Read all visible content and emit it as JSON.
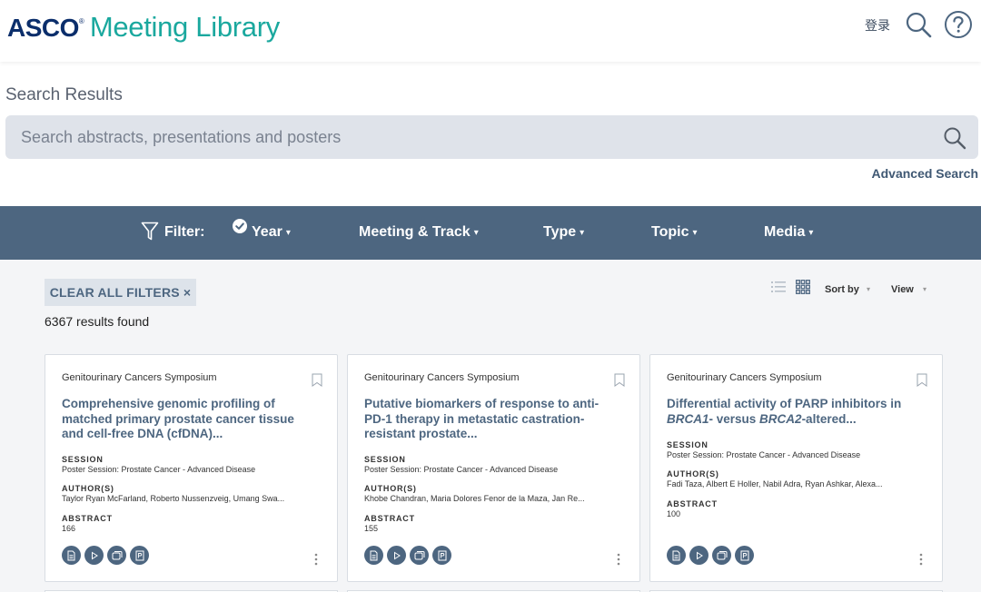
{
  "header": {
    "logo_asco": "ASCO",
    "logo_reg": "®",
    "logo_text": "Meeting Library",
    "login_label": "登录"
  },
  "search": {
    "title": "Search Results",
    "placeholder": "Search abstracts, presentations and posters",
    "value": "",
    "advanced_label": "Advanced Search"
  },
  "filterbar": {
    "filter_label": "Filter:",
    "items": [
      {
        "label": "Year",
        "checked": true
      },
      {
        "label": "Meeting & Track"
      },
      {
        "label": "Type"
      },
      {
        "label": "Topic"
      },
      {
        "label": "Media"
      }
    ],
    "caret": "▾"
  },
  "toolbar": {
    "clear_label": "CLEAR ALL FILTERS ×",
    "results_text": "6367 results found",
    "sort_label": "Sort by",
    "view_label": "View",
    "caret": "▾"
  },
  "cards": [
    {
      "meeting": "Genitourinary Cancers Symposium",
      "title": "Comprehensive genomic profiling of matched primary prostate cancer tissue and cell-free DNA (cfDNA)...",
      "session_label": "SESSION",
      "session": "Poster Session: Prostate Cancer - Advanced Disease",
      "authors_label": "AUTHOR(S)",
      "authors": "Taylor Ryan McFarland, Roberto Nussenzveig, Umang Swa...",
      "abstract_label": "ABSTRACT",
      "abstract": "166"
    },
    {
      "meeting": "Genitourinary Cancers Symposium",
      "title": "Putative biomarkers of response to anti-PD-1 therapy in metastatic castration-resistant prostate...",
      "session_label": "SESSION",
      "session": "Poster Session: Prostate Cancer - Advanced Disease",
      "authors_label": "AUTHOR(S)",
      "authors": "Khobe Chandran, Maria Dolores Fenor de la Maza, Jan Re...",
      "abstract_label": "ABSTRACT",
      "abstract": "155"
    },
    {
      "meeting": "Genitourinary Cancers Symposium",
      "title_parts": [
        "Differential activity of PARP inhibitors in ",
        "BRCA1",
        "- versus ",
        "BRCA2",
        "-altered..."
      ],
      "session_label": "SESSION",
      "session": "Poster Session: Prostate Cancer - Advanced Disease",
      "authors_label": "AUTHOR(S)",
      "authors": "Fadi Taza, Albert E Holler, Nabil Adra, Ryan Ashkar, Alexa...",
      "abstract_label": "ABSTRACT",
      "abstract": "100"
    }
  ],
  "media_icons": [
    "document-icon",
    "play-icon",
    "slides-icon",
    "poster-icon"
  ],
  "colors": {
    "brand_navy": "#0b2e6b",
    "brand_teal": "#1aa89e",
    "accent_slate": "#4d6680",
    "search_bg": "#dfe3ea"
  }
}
